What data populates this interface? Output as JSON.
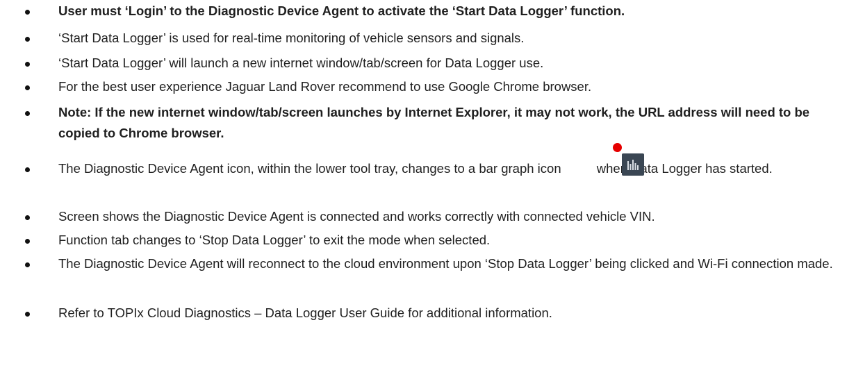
{
  "bullets": [
    {
      "text": "User must ‘Login’ to the Diagnostic Device Agent to activate the ‘Start Data Logger’ function.",
      "bold": true
    },
    {
      "text": "‘Start Data Logger’ is used for real-time monitoring of vehicle sensors and signals.",
      "bold": false
    },
    {
      "text": "‘Start Data Logger’ will launch a new internet window/tab/screen for Data Logger use.",
      "bold": false
    },
    {
      "text": "For the best user experience Jaguar Land Rover recommend to use Google Chrome browser.",
      "bold": false
    },
    {
      "text": "Note: If the new internet window/tab/screen launches by Internet Explorer, it may not work, the URL address will need to be copied to Chrome browser.",
      "bold": true
    },
    {
      "text_before_icon": "The Diagnostic Device Agent icon, within the lower tool tray, changes to a bar graph icon",
      "text_after_icon": "when Data Logger has started.",
      "icon": "bar-graph-icon",
      "icon_badge_color": "#e60000",
      "bold": false
    },
    {
      "text": "Screen shows the Diagnostic Device Agent is connected and works correctly with connected vehicle VIN.",
      "bold": false
    },
    {
      "text": "Function tab changes to ‘Stop Data Logger’ to exit the mode when selected.",
      "bold": false
    },
    {
      "text": "The Diagnostic Device Agent will reconnect to the cloud environment upon ‘Stop Data Logger’ being clicked and Wi-Fi connection made.",
      "bold": false
    },
    {
      "text": "Refer to TOPIx Cloud Diagnostics – Data Logger User Guide for additional information.",
      "bold": false
    }
  ]
}
